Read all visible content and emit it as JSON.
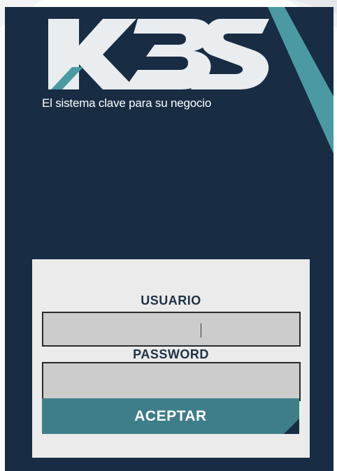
{
  "brand": {
    "logo_text": "KBS",
    "tagline": "El sistema clave para su negocio"
  },
  "login": {
    "user_label": "USUARIO",
    "user_value": "",
    "password_label": "PASSWORD",
    "password_value": "",
    "submit_label": "ACEPTAR"
  },
  "colors": {
    "panel": "#182c43",
    "accent": "#3d7e89",
    "form_bg": "#ebebeb",
    "input_bg": "#cccccc"
  },
  "icons": [
    "kbs-logo"
  ]
}
